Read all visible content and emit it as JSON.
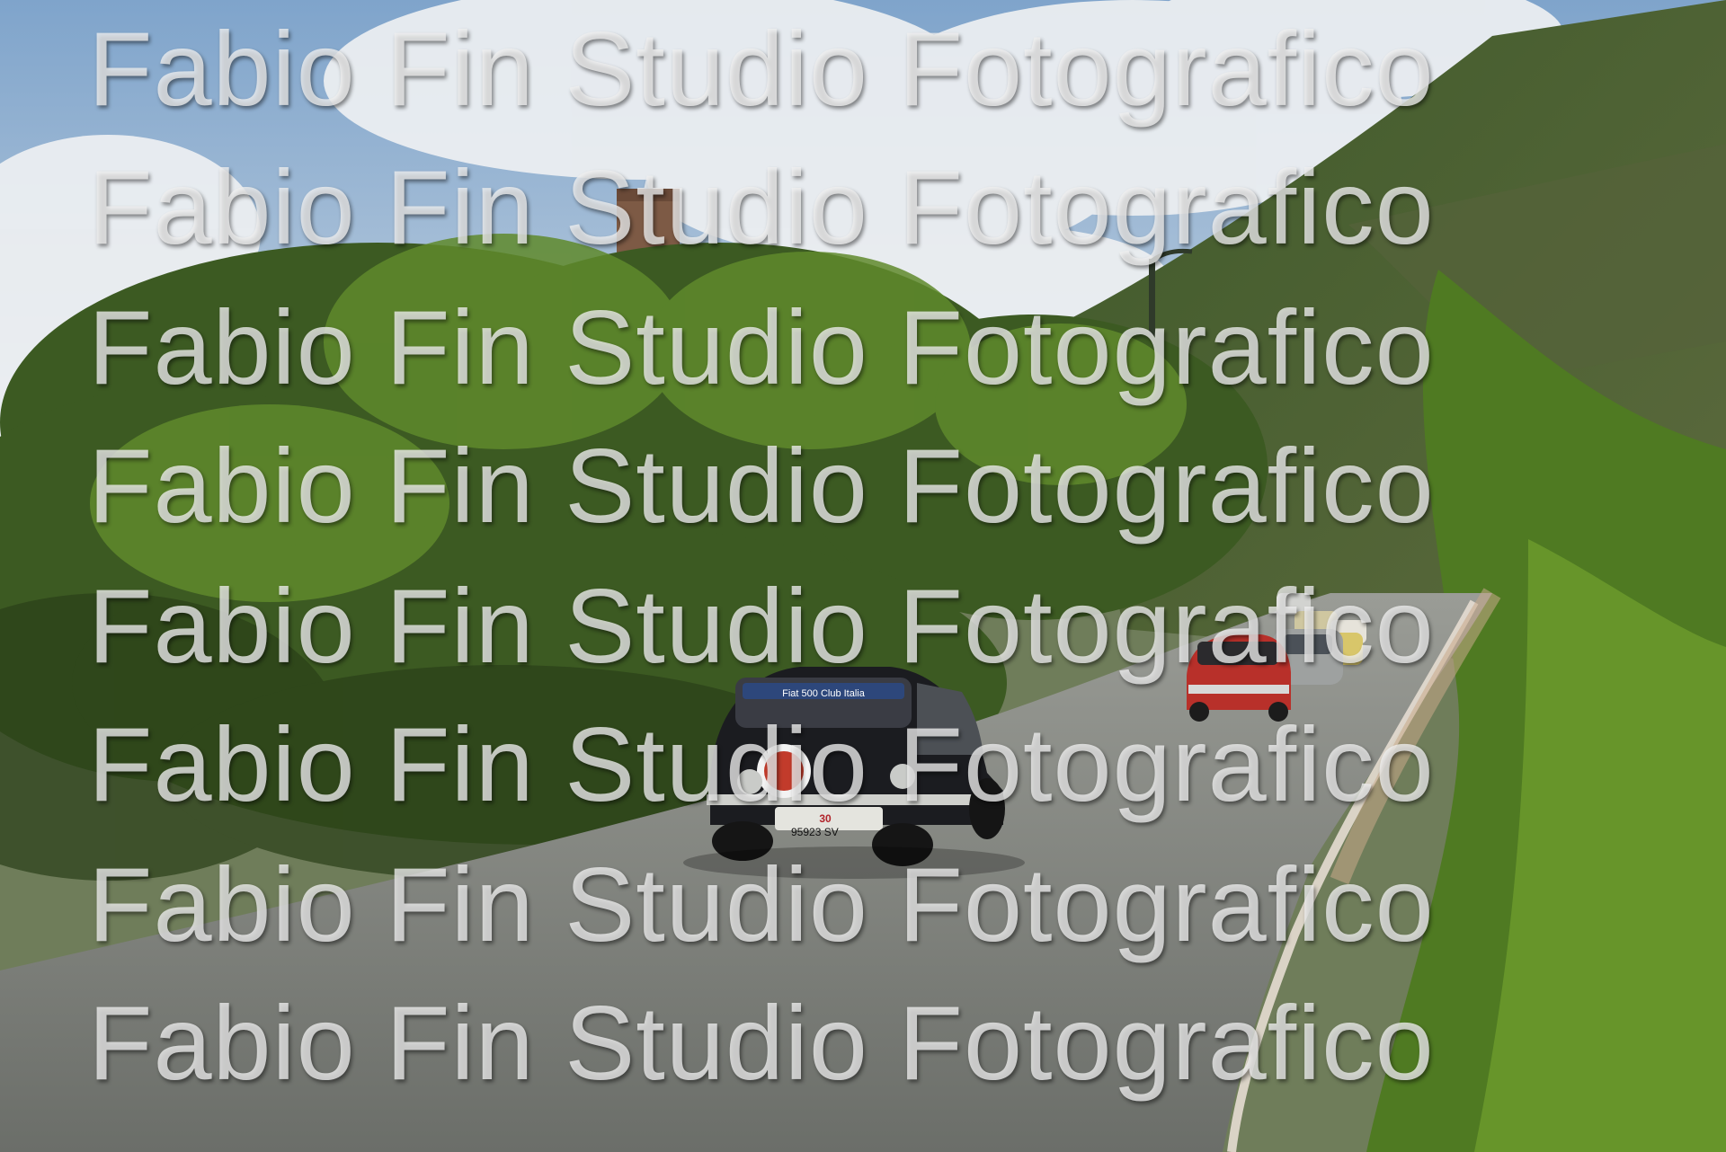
{
  "image": {
    "description_visible": false
  },
  "plates": {
    "front_plate": "95923 SV",
    "rally_plate": "30",
    "windshield_banner": "Fiat 500 Club Italia"
  },
  "watermark": {
    "text": "Fabio Fin Studio Fotografico",
    "lines": [
      "Fabio Fin Studio Fotografico",
      "Fabio Fin Studio Fotografico",
      "Fabio Fin Studio Fotografico",
      "Fabio Fin Studio Fotografico",
      "Fabio Fin Studio Fotografico",
      "Fabio Fin Studio Fotografico",
      "Fabio Fin Studio Fotografico",
      "Fabio Fin Studio Fotografico"
    ]
  },
  "colors": {
    "sky": "#8fb0d2",
    "cloud": "#eef0f2",
    "foliage_dark": "#2f4a1c",
    "foliage_light": "#6e9a2e",
    "road": "#7b7f79",
    "car_black": "#1b1c20",
    "car_red": "#b8302a"
  }
}
